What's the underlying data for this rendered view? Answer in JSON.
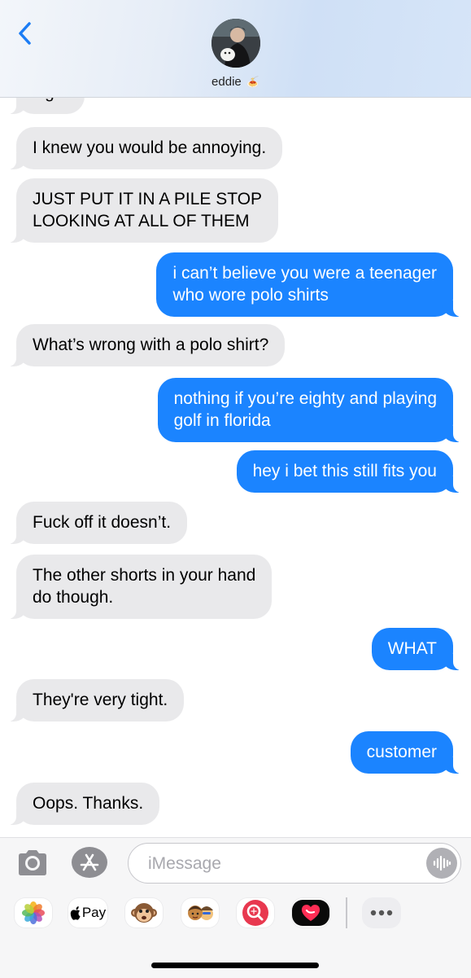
{
  "header": {
    "contact_name": "eddie",
    "contact_emoji": "🍝",
    "back_icon": "chevron-left-icon"
  },
  "messages": [
    {
      "side": "in",
      "text": "Ugh."
    },
    {
      "side": "in",
      "text": "I knew you would be annoying."
    },
    {
      "side": "in",
      "text": "JUST PUT IT IN A PILE STOP\nLOOKING AT ALL OF THEM"
    },
    {
      "side": "out",
      "text": "i can’t believe you were a teenager\nwho wore polo shirts"
    },
    {
      "side": "in",
      "text": "What’s wrong with a polo shirt?"
    },
    {
      "side": "out",
      "text": "nothing if you’re eighty and playing\ngolf in florida"
    },
    {
      "side": "out",
      "text": "hey i bet this still fits you"
    },
    {
      "side": "in",
      "text": "Fuck off it doesn’t."
    },
    {
      "side": "in",
      "text": "The other shorts in your hand\ndo though."
    },
    {
      "side": "out",
      "text": "WHAT"
    },
    {
      "side": "in",
      "text": "They're very tight."
    },
    {
      "side": "out",
      "text": "customer"
    },
    {
      "side": "in",
      "text": "Oops. Thanks."
    }
  ],
  "input": {
    "placeholder": "iMessage",
    "value": ""
  },
  "app_drawer": {
    "apple_pay_label": "Pay",
    "apps": [
      "photos-icon",
      "apple-pay-icon",
      "monkey-emoji-icon",
      "memoji-icon",
      "search-images-icon",
      "digital-touch-icon",
      "more-icon"
    ]
  },
  "colors": {
    "outgoing_bubble": "#1b84ff",
    "incoming_bubble": "#e9e9eb"
  }
}
